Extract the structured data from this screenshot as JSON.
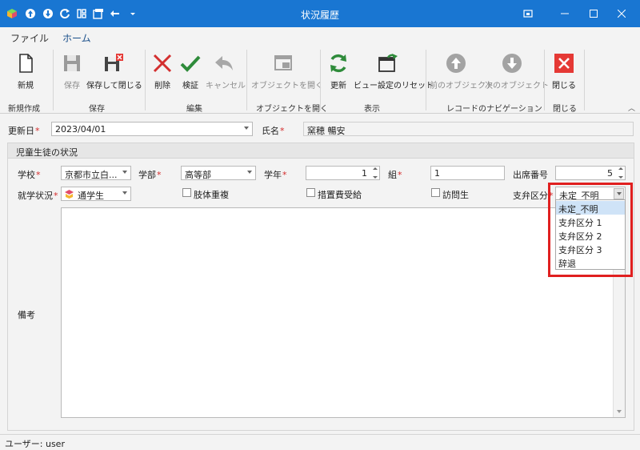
{
  "window": {
    "title": "状況履歴",
    "quick_access": [
      "app-logo-icon",
      "up-arrow-icon",
      "down-arrow-icon",
      "refresh-icon",
      "layout-icon",
      "save-layout-icon",
      "undo-icon",
      "dropdown-icon"
    ],
    "controls": [
      "restore-icon",
      "minimize-icon",
      "maximize-icon",
      "close-icon"
    ]
  },
  "ribbon": {
    "tabs": [
      {
        "label": "ファイル"
      },
      {
        "label": "ホーム"
      }
    ],
    "active_tab": "ホーム",
    "buttons": [
      {
        "label": "新規",
        "icon": "new-document-icon",
        "enabled": true
      },
      {
        "label": "保存",
        "icon": "save-icon",
        "enabled": false
      },
      {
        "label": "保存して閉じる",
        "icon": "save-close-icon",
        "enabled": true
      },
      {
        "label": "削除",
        "icon": "delete-icon",
        "enabled": true
      },
      {
        "label": "検証",
        "icon": "check-icon",
        "enabled": true
      },
      {
        "label": "キャンセル",
        "icon": "undo-icon",
        "enabled": false
      },
      {
        "label": "オブジェクトを開く",
        "icon": "window-icon",
        "enabled": false
      },
      {
        "label": "更新",
        "icon": "refresh-icon",
        "enabled": true
      },
      {
        "label": "ビュー設定のリセット",
        "icon": "reset-view-icon",
        "enabled": true
      },
      {
        "label": "前のオブジェクト",
        "icon": "up-circle-icon",
        "enabled": false
      },
      {
        "label": "次のオブジェクト",
        "icon": "down-circle-icon",
        "enabled": false
      },
      {
        "label": "閉じる",
        "icon": "close-x-icon",
        "enabled": true
      }
    ],
    "groups": [
      "新規作成",
      "保存",
      "編集",
      "オブジェクトを開く",
      "表示",
      "レコードのナビゲーション",
      "閉じる"
    ]
  },
  "form": {
    "update_date": {
      "label": "更新日",
      "value": "2023/04/01"
    },
    "name": {
      "label": "氏名",
      "value": "窯穂 暢安"
    },
    "group_title": "児童生徒の状況",
    "school": {
      "label": "学校",
      "value": "京都市立白..."
    },
    "department": {
      "label": "学部",
      "value": "高等部"
    },
    "grade": {
      "label": "学年",
      "value": "1"
    },
    "class": {
      "label": "組",
      "value": "1"
    },
    "attendance_no": {
      "label": "出席番号",
      "value": "5"
    },
    "enrollment": {
      "label": "就学状況",
      "value": "通学生"
    },
    "checkboxes": [
      {
        "label": "肢体重複",
        "checked": false
      },
      {
        "label": "措置費受給",
        "checked": false
      },
      {
        "label": "訪問生",
        "checked": false
      }
    ],
    "support_category": {
      "label": "支弁区分",
      "value": "未定_不明",
      "options": [
        "未定_不明",
        "支弁区分 1",
        "支弁区分 2",
        "支弁区分 3",
        "辞退"
      ],
      "selected_index": 0
    },
    "remarks": {
      "label": "備考",
      "value": ""
    }
  },
  "status": {
    "user": "ユーザー: user"
  },
  "colors": {
    "titlebar": "#1976d2",
    "required": "#d42a2a",
    "highlight": "#e02020",
    "selected": "#cfe3f7"
  }
}
